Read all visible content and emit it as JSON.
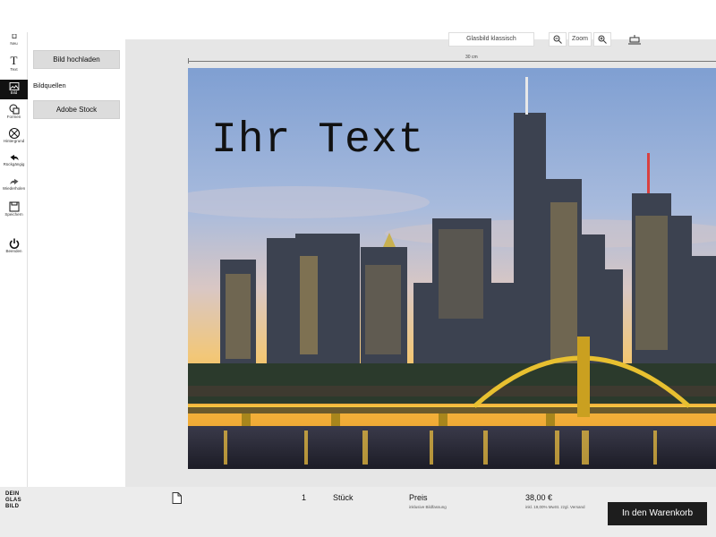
{
  "toolbar": {
    "tools": [
      {
        "label": "Neu",
        "icon": "new-icon"
      },
      {
        "label": "Text",
        "icon": "text-icon"
      },
      {
        "label": "Bild",
        "icon": "image-icon",
        "active": true
      },
      {
        "label": "Formen",
        "icon": "shapes-icon"
      },
      {
        "label": "Hintergrund",
        "icon": "background-icon"
      },
      {
        "label": "Rückgängig",
        "icon": "undo-icon"
      },
      {
        "label": "Wiederholen",
        "icon": "redo-icon"
      },
      {
        "label": "Speichern",
        "icon": "save-icon"
      },
      {
        "label": "Beenden",
        "icon": "power-icon"
      }
    ]
  },
  "panel": {
    "upload_label": "Bild hochladen",
    "sources_heading": "Bildquellen",
    "stock_label": "Adobe Stock"
  },
  "canvas": {
    "top_control_label": "Glasbild klassisch",
    "zoom_label": "Zoom",
    "ruler_label": "30 cm",
    "overlay_text": "Ihr Text"
  },
  "footer": {
    "logo_lines": [
      "DEIN",
      "GLAS",
      "BILD"
    ],
    "quantity": "1",
    "unit": "Stück",
    "price_label": "Preis",
    "price_sub": "inklusive Bildfassung",
    "price": "38,00 €",
    "price_note": "inkl. 19,00% MwSt. zzgl. Versand",
    "cart_label": "In den Warenkorb"
  },
  "colors": {
    "accent": "#1d1d1d",
    "workspace": "#e6e6e6",
    "panel_button": "#dcdcdc"
  }
}
